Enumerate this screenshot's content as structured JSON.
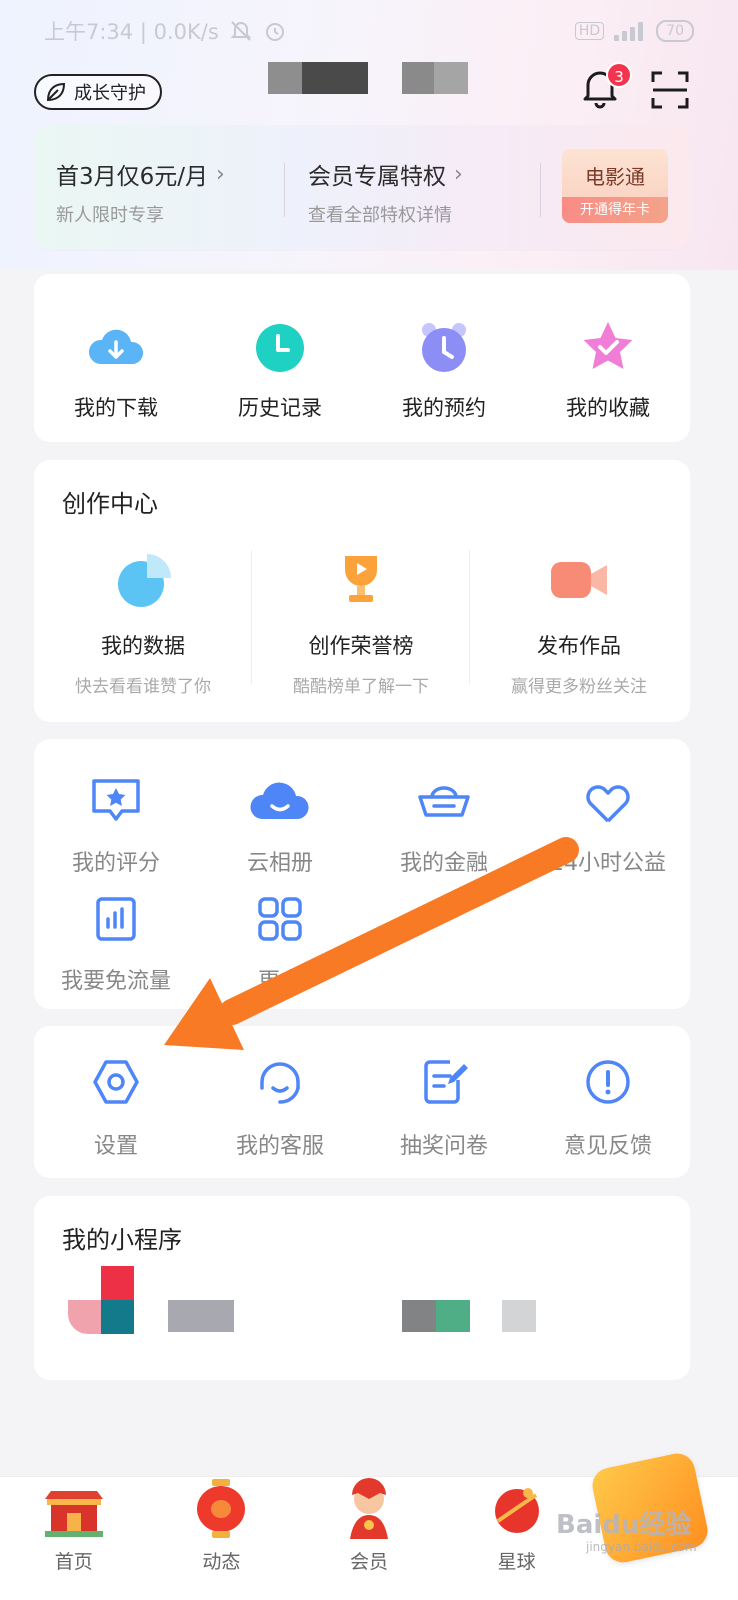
{
  "status_bar": {
    "time": "上午7:34 | 0.0K/s",
    "hd": "HD",
    "battery": "70"
  },
  "header": {
    "growth_label": "成长守护",
    "notification_count": "3"
  },
  "vip": {
    "offer_title": "首3月仅6元/月",
    "offer_sub": "新人限时专享",
    "privilege_title": "会员专属特权",
    "privilege_sub": "查看全部特权详情",
    "movie_title": "电影通",
    "movie_sub": "开通得年卡"
  },
  "quick": [
    {
      "label": "我的下载",
      "icon": "download-cloud-icon"
    },
    {
      "label": "历史记录",
      "icon": "history-clock-icon"
    },
    {
      "label": "我的预约",
      "icon": "alarm-clock-icon"
    },
    {
      "label": "我的收藏",
      "icon": "star-icon"
    }
  ],
  "create_center": {
    "title": "创作中心",
    "items": [
      {
        "title": "我的数据",
        "sub": "快去看看谁赞了你",
        "icon": "pie-chart-icon"
      },
      {
        "title": "创作荣誉榜",
        "sub": "酷酷榜单了解一下",
        "icon": "trophy-icon"
      },
      {
        "title": "发布作品",
        "sub": "赢得更多粉丝关注",
        "icon": "video-camera-icon"
      }
    ]
  },
  "tools": [
    {
      "label": "我的评分",
      "icon": "rating-icon"
    },
    {
      "label": "云相册",
      "icon": "cloud-album-icon"
    },
    {
      "label": "我的金融",
      "icon": "gold-ingot-icon"
    },
    {
      "label": "24小时公益",
      "icon": "charity-heart-icon"
    },
    {
      "label": "我要免流量",
      "icon": "data-free-icon"
    },
    {
      "label": "更多",
      "icon": "more-grid-icon"
    }
  ],
  "settings_row": [
    {
      "label": "设置",
      "icon": "settings-hex-icon"
    },
    {
      "label": "我的客服",
      "icon": "customer-service-icon"
    },
    {
      "label": "抽奖问卷",
      "icon": "survey-icon"
    },
    {
      "label": "意见反馈",
      "icon": "feedback-icon"
    }
  ],
  "mini_programs": {
    "title": "我的小程序"
  },
  "bottom_nav": [
    {
      "label": "首页",
      "icon": "home-palace-icon"
    },
    {
      "label": "动态",
      "icon": "lantern-icon"
    },
    {
      "label": "会员",
      "icon": "vip-mascot-icon"
    },
    {
      "label": "星球",
      "icon": "planet-icon"
    },
    {
      "label": "",
      "icon": "festival-badge-icon"
    }
  ],
  "watermark": {
    "text": "Baidu经验",
    "sub": "jingyan.baidu.com"
  },
  "colors": {
    "accent_blue": "#4f86f7",
    "badge_red": "#f3344f",
    "arrow_orange": "#f97a24"
  }
}
